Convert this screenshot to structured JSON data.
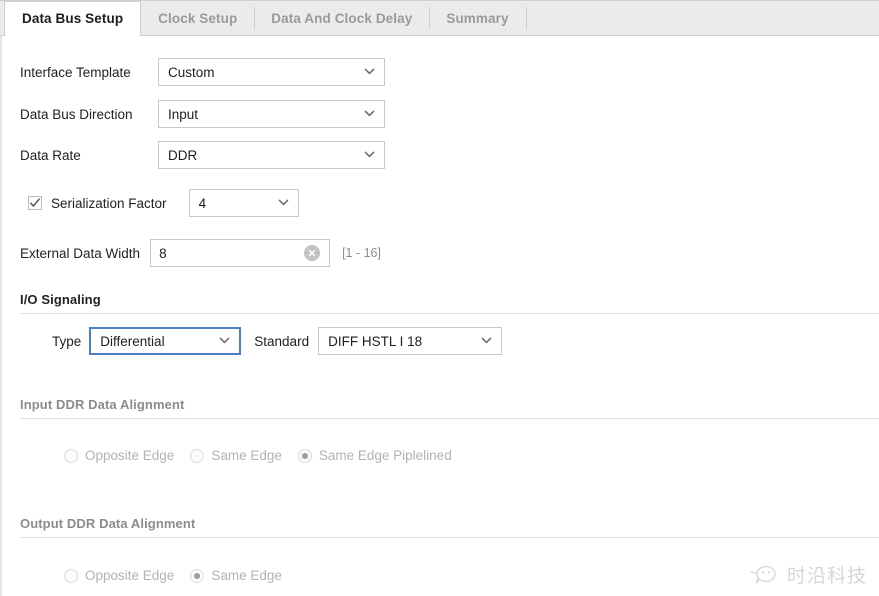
{
  "window": {
    "title": "Data Bus Setup"
  },
  "tabs": [
    {
      "label": "Data Bus Setup",
      "active": true
    },
    {
      "label": "Clock Setup",
      "active": false
    },
    {
      "label": "Data And Clock Delay",
      "active": false
    },
    {
      "label": "Summary",
      "active": false
    }
  ],
  "fields": {
    "interface_template": {
      "label": "Interface Template",
      "value": "Custom",
      "icon": "chevron-down-icon"
    },
    "data_bus_direction": {
      "label": "Data Bus Direction",
      "value": "Input",
      "icon": "chevron-down-icon"
    },
    "data_rate": {
      "label": "Data Rate",
      "value": "DDR",
      "icon": "chevron-down-icon"
    },
    "serialization_factor": {
      "label": "Serialization Factor",
      "checked": true,
      "checkbox_icon": "check-icon",
      "value": "4",
      "icon": "chevron-down-icon"
    },
    "external_data_width": {
      "label": "External Data Width",
      "value": "8",
      "placeholder": "",
      "range_hint": "[1 - 16]",
      "clear_icon": "clear-circle-icon"
    }
  },
  "io_signaling": {
    "title": "I/O Signaling",
    "type": {
      "label": "Type",
      "value": "Differential",
      "focused": true,
      "icon": "chevron-down-icon"
    },
    "standard": {
      "label": "Standard",
      "value": "DIFF HSTL I 18",
      "icon": "chevron-down-icon"
    }
  },
  "input_ddr": {
    "title": "Input DDR Data Alignment",
    "options": [
      {
        "label": "Opposite Edge",
        "selected": false
      },
      {
        "label": "Same Edge",
        "selected": false
      },
      {
        "label": "Same Edge Piplelined",
        "selected": true
      }
    ]
  },
  "output_ddr": {
    "title": "Output DDR Data Alignment",
    "options": [
      {
        "label": "Opposite Edge",
        "selected": false
      },
      {
        "label": "Same Edge",
        "selected": true
      }
    ]
  },
  "watermark": {
    "text": "时沿科技",
    "icon": "wechat-bubble-icon"
  },
  "colors": {
    "accent_focus": "#4a7ec8",
    "tab_active_text": "#1d1d1d",
    "tab_inactive_text": "#9a9a9a",
    "tabbar_bg": "#ebebeb",
    "field_border": "#c8c8c8",
    "disabled_text": "#b3b3b3",
    "section_muted": "#8c8c8c",
    "hint_text": "#8e8e8e"
  }
}
